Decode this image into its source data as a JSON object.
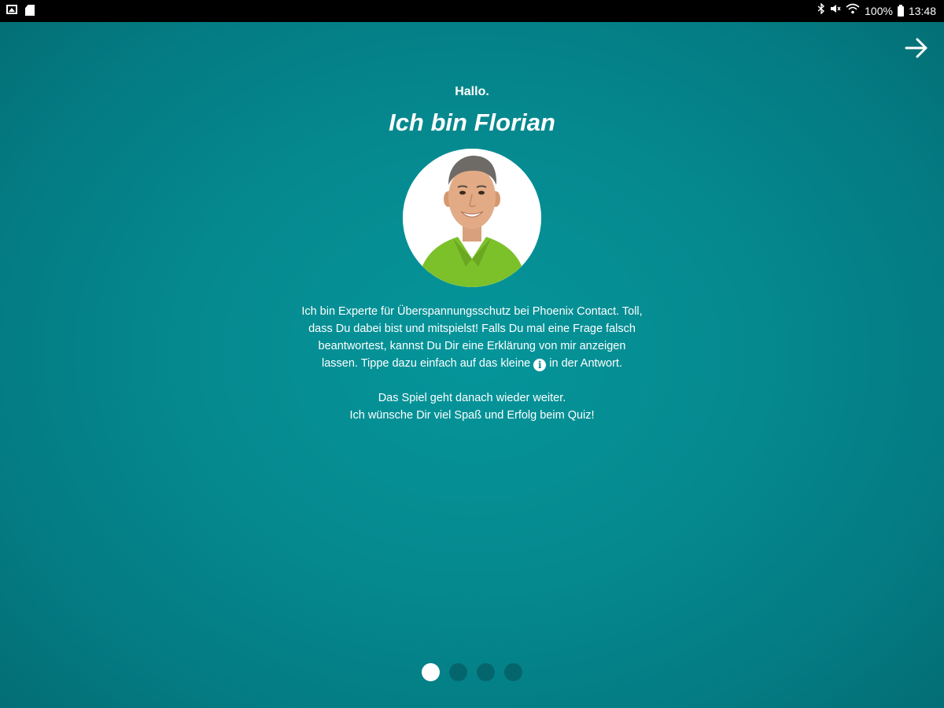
{
  "status_bar": {
    "left_icons": [
      "gallery-icon",
      "sd-card-icon"
    ],
    "right_icons": [
      "bluetooth-icon",
      "mute-icon",
      "wifi-icon"
    ],
    "battery": "100%",
    "time": "13:48"
  },
  "nav": {
    "next_icon": "arrow-right-icon"
  },
  "intro": {
    "greeting": "Hallo.",
    "title": "Ich bin Florian",
    "paragraph1_before_icon": "Ich bin Experte für Überspannungsschutz bei Phoenix Contact. Toll, dass Du dabei bist und mitspielst! Falls Du mal eine Frage falsch beantwortest, kannst Du Dir eine Erklärung von mir anzeigen lassen. Tippe dazu einfach auf das kleine",
    "info_icon_glyph": "i",
    "paragraph1_after_icon": "in der Antwort.",
    "paragraph2_line1": "Das Spiel geht danach wieder weiter.",
    "paragraph2_line2": "Ich wünsche Dir viel Spaß und Erfolg beim Quiz!"
  },
  "pager": {
    "total": 4,
    "active_index": 0
  },
  "colors": {
    "background": "#058a90",
    "dot_inactive": "#04666c",
    "dot_active": "#ffffff",
    "shirt": "#7cc02a"
  }
}
